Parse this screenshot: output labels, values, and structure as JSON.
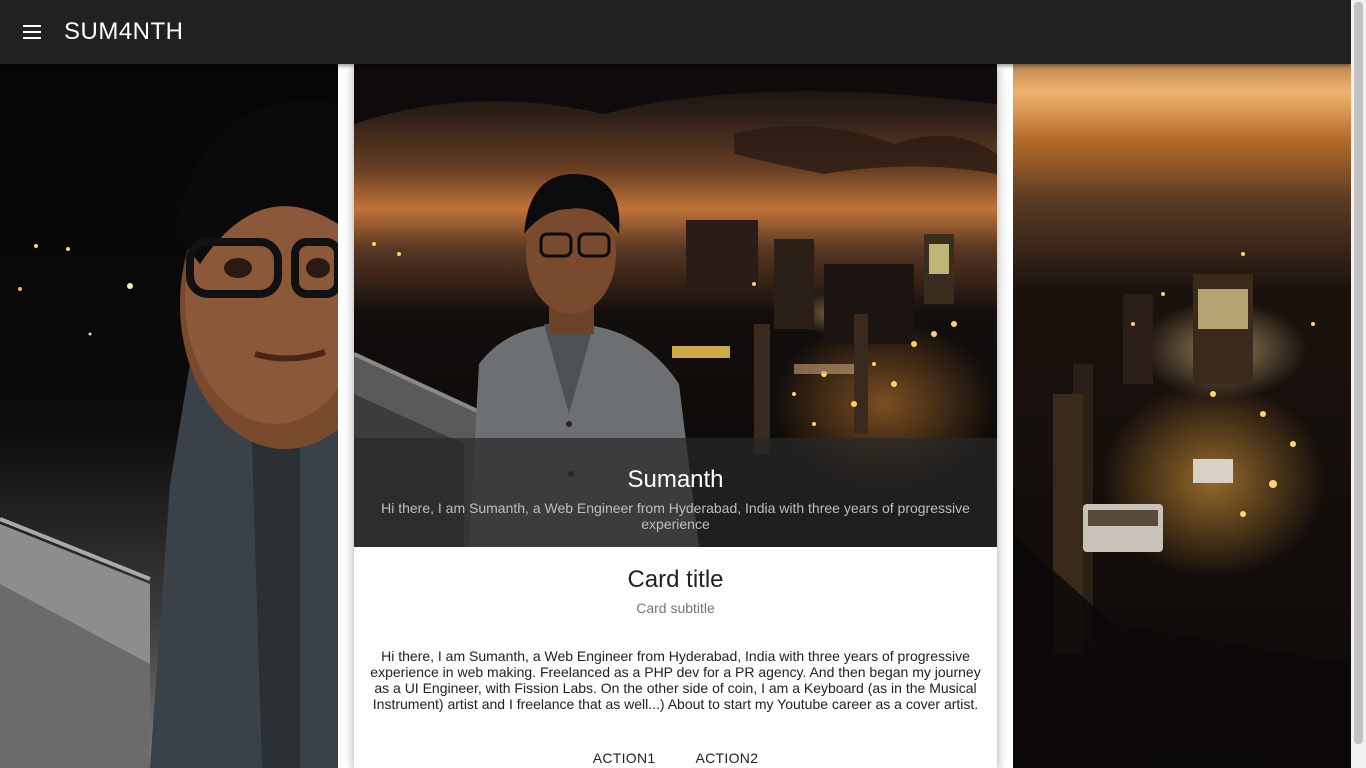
{
  "app_bar": {
    "title": "SUM4NTH",
    "menu_icon": "hamburger-menu-icon"
  },
  "hero": {
    "name": "Sumanth",
    "description": "Hi there, I am Sumanth, a Web Engineer from Hyderabad, India with three years of progressive experience"
  },
  "card": {
    "title": "Card title",
    "subtitle": "Card subtitle",
    "text": "Hi there, I am Sumanth, a Web Engineer from Hyderabad, India with three years of progressive experience in web making. Freelanced as a PHP dev for a PR agency. And then began my journey as a UI Engineer, with Fission Labs. On the other side of coin, I am a Keyboard (as in the Musical Instrument) artist and I freelance that as well...) About to start my Youtube career as a cover artist.",
    "actions": [
      "ACTION1",
      "ACTION2"
    ]
  },
  "colors": {
    "app_bar": "#212121",
    "card": "#ffffff",
    "overlay": "#282828"
  }
}
